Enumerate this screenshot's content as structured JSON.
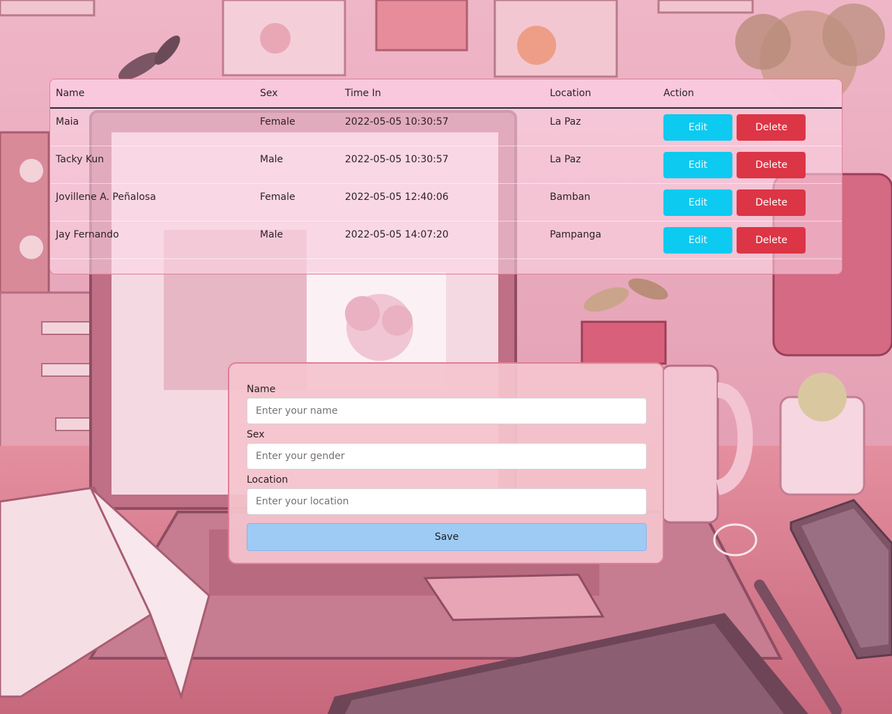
{
  "table": {
    "headers": {
      "name": "Name",
      "sex": "Sex",
      "time_in": "Time In",
      "location": "Location",
      "action": "Action"
    },
    "rows": [
      {
        "name": "Maia",
        "sex": "Female",
        "time_in": "2022-05-05 10:30:57",
        "location": "La Paz",
        "edit_label": "Edit",
        "delete_label": "Delete"
      },
      {
        "name": "Tacky Kun",
        "sex": "Male",
        "time_in": "2022-05-05 10:30:57",
        "location": "La Paz",
        "edit_label": "Edit",
        "delete_label": "Delete"
      },
      {
        "name": "Jovillene A. Peñalosa",
        "sex": "Female",
        "time_in": "2022-05-05 12:40:06",
        "location": "Bamban",
        "edit_label": "Edit",
        "delete_label": "Delete"
      },
      {
        "name": "Jay Fernando",
        "sex": "Male",
        "time_in": "2022-05-05 14:07:20",
        "location": "Pampanga",
        "edit_label": "Edit",
        "delete_label": "Delete"
      }
    ]
  },
  "form": {
    "name_label": "Name",
    "name_placeholder": "Enter your name",
    "name_value": "",
    "sex_label": "Sex",
    "sex_placeholder": "Enter your gender",
    "sex_value": "",
    "location_label": "Location",
    "location_placeholder": "Enter your location",
    "location_value": "",
    "save_label": "Save"
  },
  "colors": {
    "edit_button": "#0dcaf0",
    "delete_button": "#dc3545",
    "save_button": "#9dcbf4",
    "panel_border": "#de7e98"
  }
}
